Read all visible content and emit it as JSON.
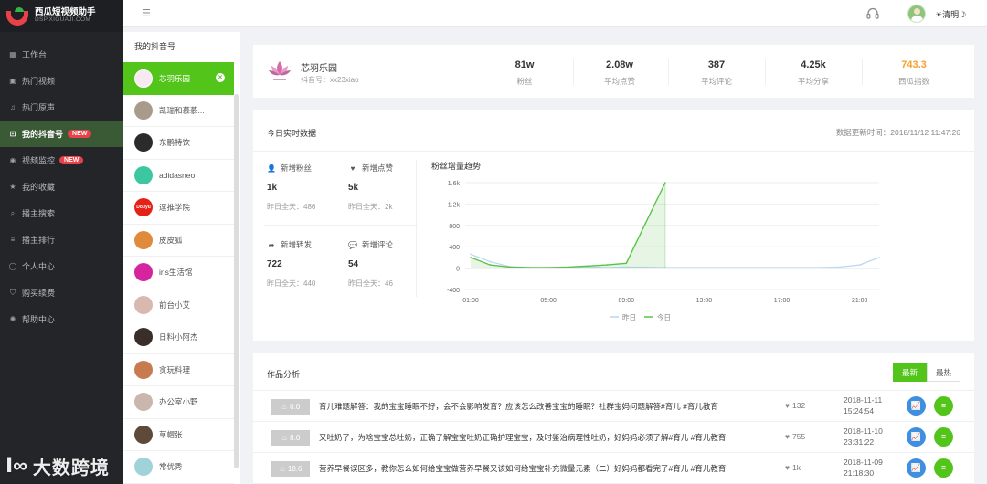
{
  "brand": {
    "title": "西瓜短视频助手",
    "subtitle": "DSP.XIGUAJI.COM"
  },
  "nav": {
    "items": [
      {
        "label": "工作台",
        "icon": "dashboard-icon"
      },
      {
        "label": "热门视频",
        "icon": "video-icon"
      },
      {
        "label": "热门原声",
        "icon": "music-icon"
      },
      {
        "label": "我的抖音号",
        "icon": "account-icon",
        "badge": "NEW",
        "active": true
      },
      {
        "label": "视频监控",
        "icon": "monitor-icon",
        "badge": "NEW"
      },
      {
        "label": "我的收藏",
        "icon": "star-icon"
      },
      {
        "label": "播主搜索",
        "icon": "search-icon"
      },
      {
        "label": "播主排行",
        "icon": "ranking-icon"
      },
      {
        "label": "个人中心",
        "icon": "user-icon"
      },
      {
        "label": "购买续费",
        "icon": "cart-icon"
      },
      {
        "label": "帮助中心",
        "icon": "help-icon"
      }
    ]
  },
  "topbar": {
    "menu_icon": "☰",
    "username": "☀清明☽"
  },
  "accounts": {
    "title": "我的抖音号",
    "items": [
      {
        "name": "芯羽乐园",
        "color": "#f6e9f2",
        "tag": "",
        "active": true
      },
      {
        "name": "凯瑞和慕慕...",
        "color": "#a89b8b",
        "tag": ""
      },
      {
        "name": "东鹏特饮",
        "color": "#2b2b2b",
        "tag": ""
      },
      {
        "name": "adidasneo",
        "color": "#3cc7a0",
        "tag": ""
      },
      {
        "name": "逗推学院",
        "color": "#e62117",
        "tag": "Douyu"
      },
      {
        "name": "皮皮狐",
        "color": "#e08a3b",
        "tag": ""
      },
      {
        "name": "ins生活馆",
        "color": "#d6249f",
        "tag": ""
      },
      {
        "name": "前台小艾",
        "color": "#d9b8b0",
        "tag": ""
      },
      {
        "name": "日料小阿杰",
        "color": "#3a2e2a",
        "tag": ""
      },
      {
        "name": "贪玩料理",
        "color": "#c87b4f",
        "tag": ""
      },
      {
        "name": "办公室小野",
        "color": "#c9b7ad",
        "tag": ""
      },
      {
        "name": "草帽张",
        "color": "#5d4a3b",
        "tag": ""
      },
      {
        "name": "常优秀",
        "color": "#9fd3d9",
        "tag": ""
      }
    ]
  },
  "profile": {
    "name": "芯羽乐园",
    "douyin_id": "抖音号：xx23xiao",
    "stats": [
      {
        "value": "81w",
        "label": "粉丝",
        "color": "#333333"
      },
      {
        "value": "2.08w",
        "label": "平均点赞",
        "color": "#333333"
      },
      {
        "value": "387",
        "label": "平均评论",
        "color": "#333333"
      },
      {
        "value": "4.25k",
        "label": "平均分享",
        "color": "#333333"
      },
      {
        "value": "743.3",
        "label": "西瓜指数",
        "color": "#f5a02d"
      }
    ]
  },
  "realtime": {
    "title": "今日实时数据",
    "updated": "数据更新时间：2018/11/12 11:47:26",
    "kpis": {
      "fans": {
        "label": "新增粉丝",
        "value": "1k",
        "yesterday": "昨日全天：486"
      },
      "likes": {
        "label": "新增点赞",
        "value": "5k",
        "yesterday": "昨日全天：2k"
      },
      "shares": {
        "label": "新增转发",
        "value": "722",
        "yesterday": "昨日全天：440"
      },
      "comments": {
        "label": "新增评论",
        "value": "54",
        "yesterday": "昨日全天：46"
      }
    }
  },
  "chart_data": {
    "type": "line",
    "title": "粉丝增量趋势",
    "x": [
      "01:00",
      "02:00",
      "03:00",
      "04:00",
      "05:00",
      "06:00",
      "07:00",
      "08:00",
      "09:00",
      "10:00",
      "11:00",
      "12:00",
      "13:00",
      "14:00",
      "15:00",
      "16:00",
      "17:00",
      "18:00",
      "19:00",
      "20:00",
      "21:00",
      "22:00"
    ],
    "xticks": [
      "01:00",
      "05:00",
      "09:00",
      "13:00",
      "17:00",
      "21:00"
    ],
    "ylim": [
      -400,
      1600
    ],
    "yticks": [
      -400,
      0,
      400,
      800,
      1200,
      1600
    ],
    "ytick_labels": [
      "-400",
      "0",
      "400",
      "800",
      "1.2k",
      "1.6k"
    ],
    "grid": true,
    "legend_position": "bottom",
    "series": [
      {
        "name": "昨日",
        "color": "#b9d6f2",
        "values": [
          260,
          120,
          30,
          10,
          5,
          10,
          20,
          10,
          20,
          15,
          10,
          10,
          10,
          10,
          10,
          10,
          10,
          10,
          10,
          20,
          60,
          200
        ]
      },
      {
        "name": "今日",
        "color": "#5bc24a",
        "values": [
          200,
          60,
          20,
          10,
          10,
          20,
          40,
          60,
          90,
          850,
          1600
        ]
      }
    ]
  },
  "works": {
    "title": "作品分析",
    "tabs": [
      {
        "label": "最新",
        "active": true
      },
      {
        "label": "最热",
        "active": false
      }
    ],
    "rows": [
      {
        "score": "0.0",
        "title": "育儿难题解答：我的宝宝睡眠不好，会不会影响发育？应该怎么改善宝宝的睡眠？社群宝妈问题解答#育儿 #育儿教育",
        "likes": "132",
        "date": "2018-11-11",
        "time": "15:24:54"
      },
      {
        "score": "8.0",
        "title": "又吐奶了，为啥宝宝总吐奶，正确了解宝宝吐奶正确护理宝宝，及时鉴治病理性吐奶，好妈妈必须了解#育儿 #育儿教育",
        "likes": "755",
        "date": "2018-11-10",
        "time": "23:31:22"
      },
      {
        "score": "18.6",
        "title": "营养早餐误区多，教你怎么如何给宝宝做营养早餐又该如何给宝宝补充微量元素（二）好妈妈都看完了#育儿 #育儿教育",
        "likes": "1k",
        "date": "2018-11-09",
        "time": "21:18:30"
      }
    ]
  },
  "watermark": {
    "logo": "Ⅰ∞",
    "text": "大数跨境"
  }
}
